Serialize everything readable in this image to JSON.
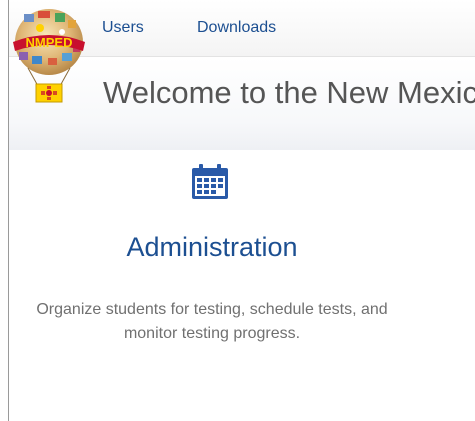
{
  "nav": {
    "logo_text": "NMPED",
    "links": [
      {
        "label": "Users"
      },
      {
        "label": "Downloads"
      }
    ]
  },
  "welcome": {
    "title": "Welcome to the New Mexico"
  },
  "card": {
    "icon": "calendar-icon",
    "title": "Administration",
    "description": "Organize students for testing, schedule tests, and monitor testing progress."
  },
  "colors": {
    "link": "#1c4f91",
    "icon": "#2a5aa8",
    "heading": "#555555",
    "description": "#707070",
    "logo_red": "#c8102e",
    "logo_yellow": "#ffd100"
  }
}
